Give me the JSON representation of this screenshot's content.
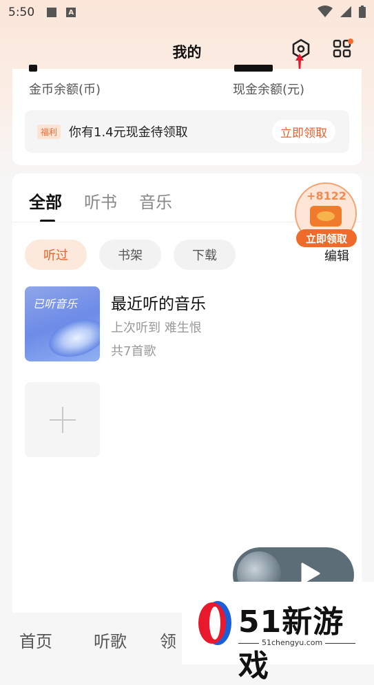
{
  "status_bar": {
    "time": "5:50"
  },
  "header": {
    "title": "我的"
  },
  "wallet": {
    "coin_label": "金币余额(币)",
    "cash_label": "现金余额(元)",
    "welfare_tag": "福利",
    "welfare_text": "你有1.4元现金待领取",
    "claim_button": "立即领取"
  },
  "tabs": [
    {
      "label": "全部",
      "active": true
    },
    {
      "label": "听书",
      "active": false
    },
    {
      "label": "音乐",
      "active": false
    }
  ],
  "filters": [
    {
      "label": "听过",
      "active": true
    },
    {
      "label": "书架",
      "active": false
    },
    {
      "label": "下载",
      "active": false
    }
  ],
  "edit_label": "编辑",
  "promo": {
    "count": "+8122",
    "label": "立即领取"
  },
  "playlist": {
    "cover_text": "已听音乐",
    "title": "最近听的音乐",
    "last_played": "上次听到 难生恨",
    "count": "共7首歌"
  },
  "bottom_nav": [
    {
      "label": "首页"
    },
    {
      "label": "听歌"
    },
    {
      "label": "领"
    }
  ],
  "watermark": {
    "brand": "51新游戏",
    "url": "51chengyu.com"
  },
  "colors": {
    "accent": "#e8602c",
    "accent_light": "#fde8dc"
  }
}
